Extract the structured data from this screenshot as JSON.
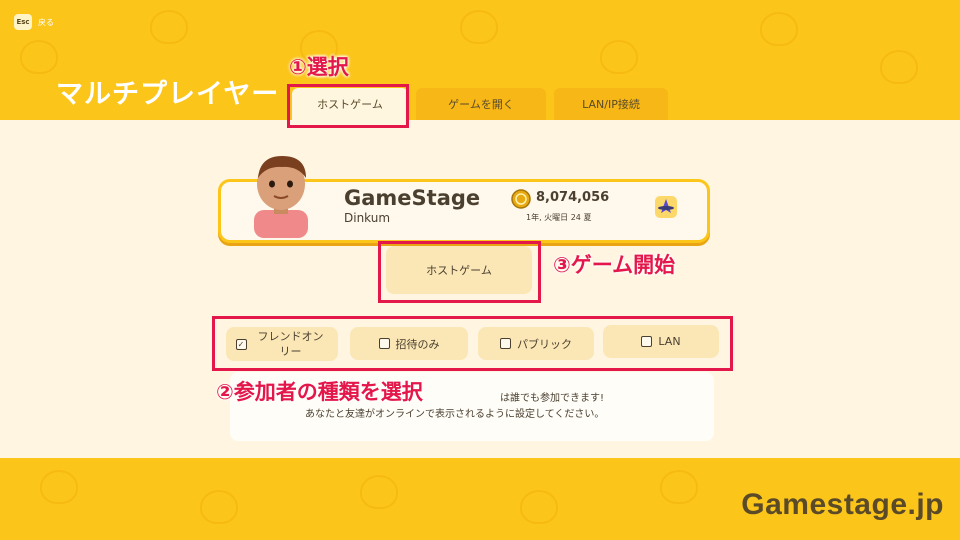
{
  "esc": {
    "key": "Esc",
    "label": "戻る"
  },
  "title": "マルチプレイヤー",
  "tabs": [
    {
      "label": "ホストゲーム",
      "active": true
    },
    {
      "label": "ゲームを開く",
      "active": false
    },
    {
      "label": "LAN/IP接続",
      "active": false
    }
  ],
  "profile": {
    "name": "GameStage",
    "subtitle": "Dinkum",
    "coins": "8,074,056",
    "date": "1年, 火曜日 24 夏"
  },
  "host_button": "ホストゲーム",
  "options": [
    {
      "label": "フレンドオンリー",
      "checked": true
    },
    {
      "label": "招待のみ",
      "checked": false
    },
    {
      "label": "パブリック",
      "checked": false
    },
    {
      "label": "LAN",
      "checked": false
    }
  ],
  "description": {
    "line1": "は誰でも参加できます!",
    "line2": "あなたと友達がオンラインで表示されるように設定してください。"
  },
  "annotations": {
    "a1": "①選択",
    "a2": "②参加者の種類を選択",
    "a3": "③ゲーム開始"
  },
  "watermark": "Gamestage.jp",
  "colors": {
    "highlight": "#e4174a",
    "background": "#fcc51a",
    "panel": "#fff5e1"
  }
}
